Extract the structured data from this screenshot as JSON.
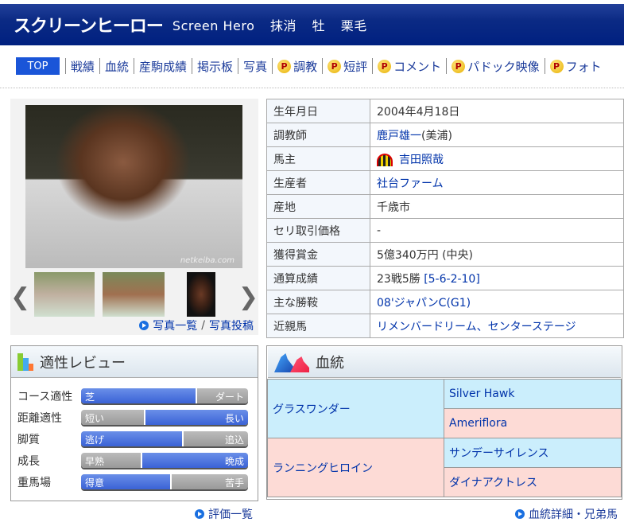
{
  "header": {
    "name": "スクリーンヒーロー",
    "english": "Screen Hero",
    "status": "抹消",
    "sex": "牡",
    "color": "栗毛"
  },
  "nav": {
    "top": "TOP",
    "items": [
      "戦績",
      "血統",
      "産駒成績",
      "掲示板",
      "写真"
    ],
    "premium_items": [
      "調教",
      "短評",
      "コメント",
      "パドック映像",
      "フォト"
    ],
    "premium_badge": "P"
  },
  "photo": {
    "watermark": "netkeiba.com",
    "links": [
      "写真一覧",
      "写真投稿"
    ],
    "separator": "/"
  },
  "info": [
    {
      "k": "生年月日",
      "v": "2004年4月18日"
    },
    {
      "k": "調教師",
      "v": "鹿戸雄一",
      "v2": "(美浦)"
    },
    {
      "k": "馬主",
      "v": "吉田照哉"
    },
    {
      "k": "生産者",
      "v": "社台ファーム"
    },
    {
      "k": "産地",
      "v": "千歳市"
    },
    {
      "k": "セリ取引価格",
      "v": "-"
    },
    {
      "k": "獲得賞金",
      "v": "5億340万円 (中央)"
    },
    {
      "k": "通算成績",
      "v": "23戦5勝",
      "v2": "[5-6-2-10]"
    },
    {
      "k": "主な勝鞍",
      "v": "08'ジャパンC(G1)"
    },
    {
      "k": "近親馬",
      "v": "リメンバードリーム、センターステージ"
    }
  ],
  "aptitude": {
    "title": "適性レビュー",
    "rows": [
      {
        "label": "コース適性",
        "left": "芝",
        "right": "ダート",
        "blue_side": "left",
        "fraction": 0.69
      },
      {
        "label": "距離適性",
        "left": "短い",
        "right": "長い",
        "blue_side": "right",
        "fraction": 0.62
      },
      {
        "label": "脚質",
        "left": "逃げ",
        "right": "追込",
        "blue_side": "left",
        "fraction": 0.61
      },
      {
        "label": "成長",
        "left": "早熟",
        "right": "晩成",
        "blue_side": "right",
        "fraction": 0.64
      },
      {
        "label": "重馬場",
        "left": "得意",
        "right": "苦手",
        "blue_side": "left",
        "fraction": 0.54
      }
    ],
    "more": "評価一覧"
  },
  "pedigree": {
    "title": "血統",
    "sire": "グラスワンダー",
    "sire_sire": "Silver Hawk",
    "sire_dam": "Ameriflora",
    "dam": "ランニングヒロイン",
    "dam_sire": "サンデーサイレンス",
    "dam_dam": "ダイナアクトレス",
    "more": "血統詳細・兄弟馬"
  },
  "colors": {
    "header": "#0b2a84",
    "top_button": "#1a55d8",
    "bar_blue": "#3a62d6",
    "male": "#cbeefc",
    "female": "#fddbd6"
  }
}
